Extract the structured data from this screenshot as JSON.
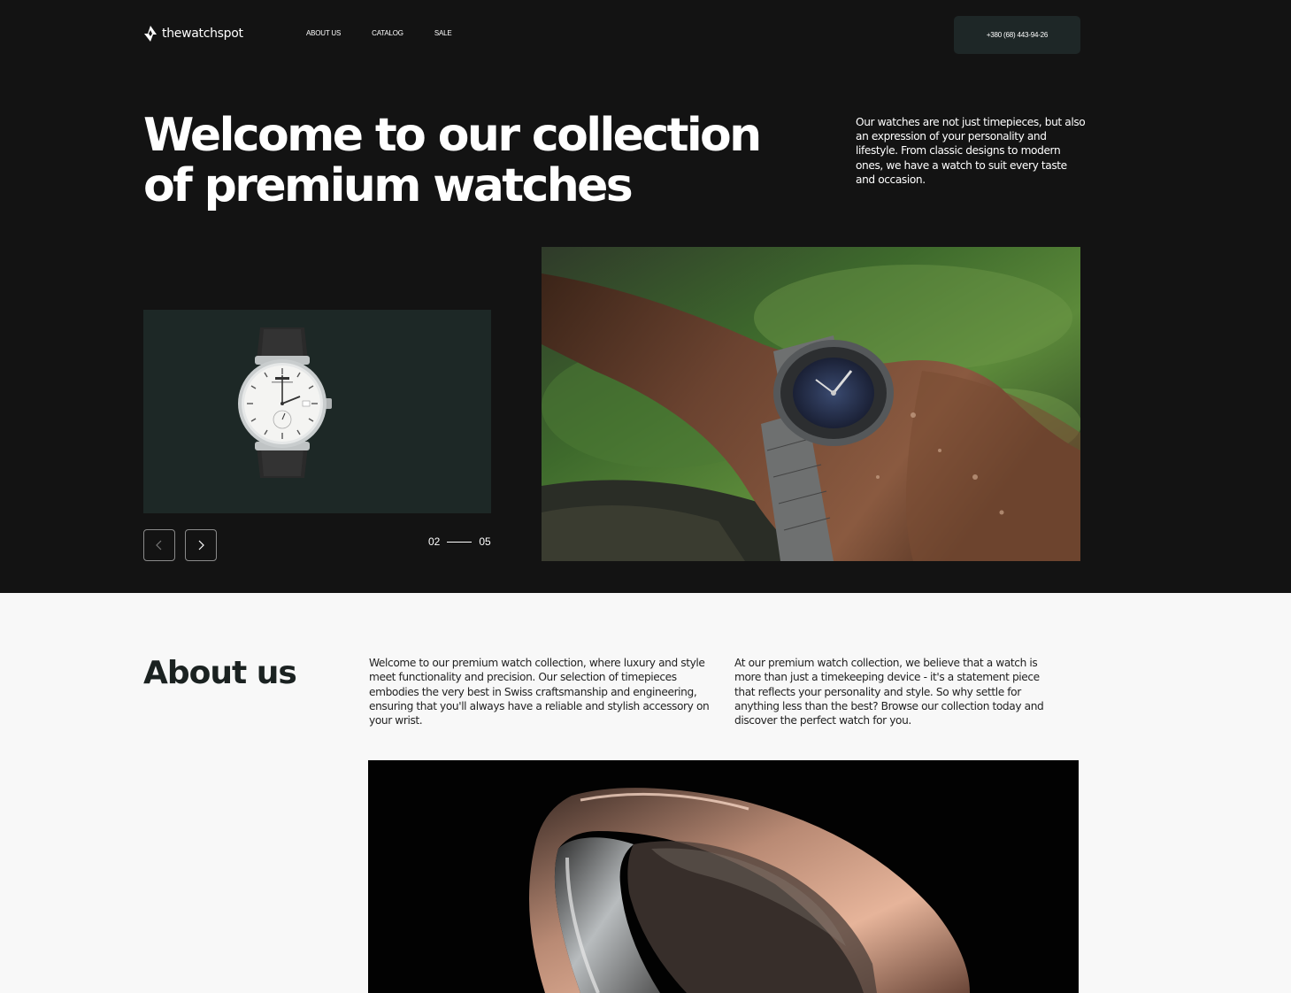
{
  "header": {
    "logo_text": "thewatchspot",
    "nav": [
      "ABOUT US",
      "CATALOG",
      "SALE"
    ],
    "phone": "+380 (68) 443-94-26"
  },
  "hero": {
    "title": "Welcome to our collection of premium watches",
    "description": "Our watches are not just timepieces, but also an expression of your personality and lifestyle. From classic designs to modern ones, we have a watch to suit every taste and occasion.",
    "slider": {
      "current": "02",
      "total": "05"
    }
  },
  "about": {
    "title": "About us",
    "paragraph_1": "Welcome to our premium watch collection, where luxury and style meet functionality and precision. Our selection of timepieces embodies the very best in Swiss craftsmanship and engineering, ensuring that you'll always have a reliable and stylish accessory on your wrist.",
    "paragraph_2": "At our premium watch collection, we believe that a watch is more than just a timekeeping device - it's a statement piece that reflects your personality and style. So why settle for anything less than the best? Browse our collection today and discover the perfect watch for you."
  },
  "colors": {
    "hero_bg": "#131313",
    "card_bg": "#1d2826",
    "button_bg": "#1e2727",
    "page_bg": "#f8f8f8"
  }
}
